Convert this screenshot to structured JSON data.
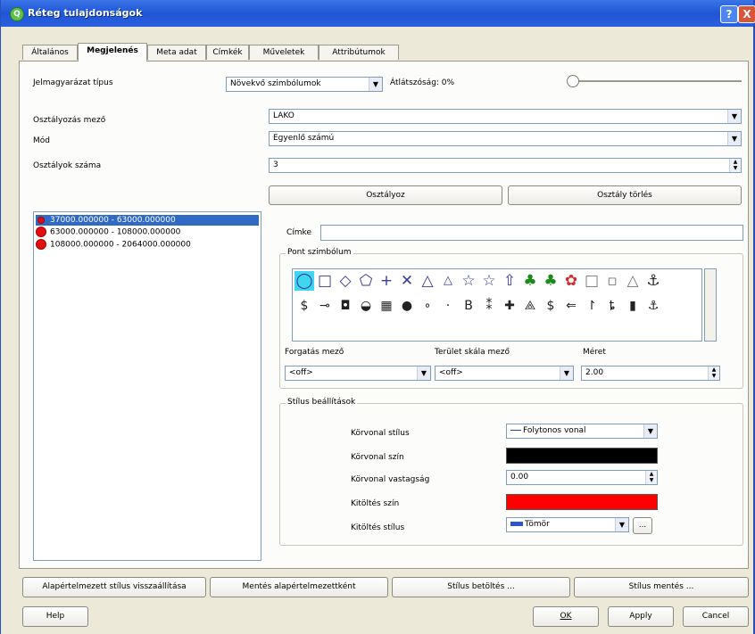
{
  "window": {
    "title": "Réteg tulajdonságok",
    "help_btn": "?",
    "close_btn": "X",
    "app_icon": "Q"
  },
  "tabs": [
    {
      "label": "Általános"
    },
    {
      "label": "Megjelenés"
    },
    {
      "label": "Meta adat"
    },
    {
      "label": "Címkék"
    },
    {
      "label": "Műveletek"
    },
    {
      "label": "Attribútumok"
    }
  ],
  "legend": {
    "type_label": "Jelmagyarázat típus",
    "type_value": "Növekvő szimbólumok",
    "transparency_label": "Átlátszóság: 0%",
    "transparency_value": 0
  },
  "classification": {
    "field_label": "Osztályozás mező",
    "field_value": "LAKO",
    "mode_label": "Mód",
    "mode_value": "Egyenlő számú",
    "count_label": "Osztályok száma",
    "count_value": "3",
    "classify_btn": "Osztályoz",
    "delete_btn": "Osztály törlés"
  },
  "classes": [
    {
      "label": "37000.000000 - 63000.000000",
      "selected": true,
      "color": "#e01010"
    },
    {
      "label": "63000.000000 - 108000.000000",
      "selected": false,
      "color": "#e01010"
    },
    {
      "label": "108000.000000 - 2064000.000000",
      "selected": false,
      "color": "#e01010"
    }
  ],
  "symbol": {
    "label_label": "Címke",
    "label_value": "",
    "point_symbol_title": "Pont szimbólum",
    "row1": [
      "◯",
      "□",
      "◇",
      "⬠",
      "+",
      "✕",
      "△",
      "△",
      "☆",
      "☆",
      "⇧",
      "♣",
      "♣",
      "✿",
      "□",
      "▫",
      "△",
      "⚓"
    ],
    "row2": [
      "$",
      "⊸",
      "◘",
      "◒",
      "▦",
      "●",
      "∘",
      "·",
      "B",
      "⁑",
      "✚",
      "⟁",
      "$",
      "⇐",
      "↾",
      "ȶ",
      "▮",
      "⚓"
    ],
    "rotation_label": "Forgatás mező",
    "rotation_value": "<off>",
    "scale_label": "Terület skála mező",
    "scale_value": "<off>",
    "size_label": "Méret",
    "size_value": "2.00"
  },
  "style": {
    "title": "Stílus beállítások",
    "outline_style_label": "Körvonal stílus",
    "outline_style_value": "Folytonos vonal",
    "outline_color_label": "Körvonal szín",
    "outline_color": "#000000",
    "outline_width_label": "Körvonal vastagság",
    "outline_width_value": "0.00",
    "fill_color_label": "Kitöltés szín",
    "fill_color": "#ff0000",
    "fill_style_label": "Kitöltés stílus",
    "fill_style_value": "Tömör",
    "more_btn": "..."
  },
  "bottom_buttons": {
    "restore_default": "Alapértelmezett stílus visszaállítása",
    "save_default": "Mentés alapértelmezettként",
    "load_style": "Stílus betöltés ...",
    "save_style": "Stílus mentés ...",
    "help": "Help",
    "ok": "OK",
    "apply": "Apply",
    "cancel": "Cancel"
  }
}
